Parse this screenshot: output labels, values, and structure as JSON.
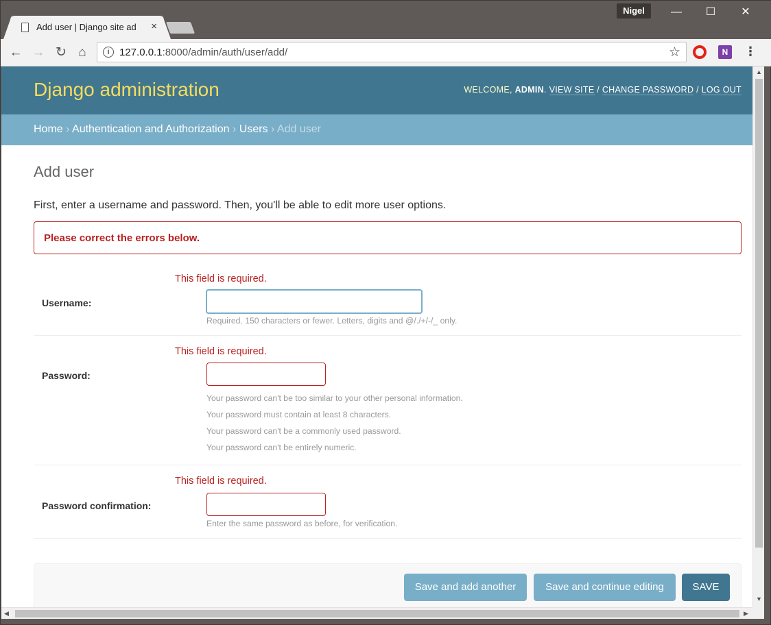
{
  "browser": {
    "tab_title": "Add user | Django site ad",
    "tab_close": "×",
    "profile_name": "Nigel",
    "window_controls": {
      "minimize": "—",
      "maximize": "☐",
      "close": "✕"
    },
    "nav": {
      "back": "←",
      "forward": "→",
      "reload": "↻",
      "home": "⌂"
    },
    "info_glyph": "i",
    "url_host": "127.0.0.1",
    "url_rest": ":8000/admin/auth/user/add/",
    "star_glyph": "☆",
    "onenote_glyph": "N",
    "menu_glyph": "⋮"
  },
  "header": {
    "site_name": "Django administration",
    "welcome": "WELCOME,",
    "username": "ADMIN",
    "period": ".",
    "view_site": "VIEW SITE",
    "sep1": "/",
    "change_password": "CHANGE PASSWORD",
    "sep2": "/",
    "log_out": "LOG OUT"
  },
  "breadcrumbs": {
    "home": "Home",
    "app": "Authentication and Authorization",
    "model": "Users",
    "current": "Add user",
    "sep": "›"
  },
  "page": {
    "title": "Add user",
    "intro": "First, enter a username and password. Then, you'll be able to edit more user options.",
    "errornote": "Please correct the errors below."
  },
  "fields": {
    "username": {
      "error": "This field is required.",
      "label": "Username:",
      "value": "",
      "help": "Required. 150 characters or fewer. Letters, digits and @/./+/-/_ only."
    },
    "password1": {
      "error": "This field is required.",
      "label": "Password:",
      "value": "",
      "help": [
        "Your password can't be too similar to your other personal information.",
        "Your password must contain at least 8 characters.",
        "Your password can't be a commonly used password.",
        "Your password can't be entirely numeric."
      ]
    },
    "password2": {
      "error": "This field is required.",
      "label": "Password confirmation:",
      "value": "",
      "help": "Enter the same password as before, for verification."
    }
  },
  "actions": {
    "save_add_another": "Save and add another",
    "save_continue": "Save and continue editing",
    "save": "SAVE"
  },
  "colors": {
    "header_bg": "#417690",
    "breadcrumb_bg": "#79aec8",
    "brand_yellow": "#f5dd5d",
    "error_red": "#ba2121"
  },
  "scroll_glyphs": {
    "up": "▲",
    "down": "▼",
    "left": "◀",
    "right": "▶"
  }
}
